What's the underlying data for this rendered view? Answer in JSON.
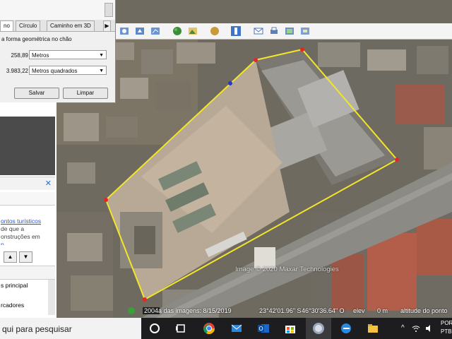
{
  "ruler": {
    "tabs": [
      "no",
      "Círculo",
      "Caminho em 3D"
    ],
    "tab_arrow": "▶",
    "instructions": "a forma geométrica no chão",
    "perimeter": {
      "value": "258,89",
      "unit": "Metros"
    },
    "area": {
      "value": "3.983,22",
      "unit": "Metros quadrados"
    },
    "save_label": "Salvar",
    "clear_label": "Limpar"
  },
  "left_panel": {
    "close": "✕",
    "link_line": "ontos turísticos",
    "text_line1": "de que a",
    "text_line2": "onstruções em",
    "text_line3": "p...",
    "item1": "s principal",
    "item2": "rcadores"
  },
  "map": {
    "copyright": "Image © 2020 Maxar Technologies"
  },
  "status": {
    "year": "2004",
    "imagery_date": "a das imagens: 8/15/2019",
    "lat": "23°42'01.96\" S",
    "lon": "46°30'36.64\" O",
    "elev_label": "elev",
    "elev_value": "0 m",
    "eye_alt": "altitude do ponto"
  },
  "taskbar": {
    "search_text": "qui para pesquisar",
    "lang": "POR",
    "lang2": "PTB"
  },
  "colors": {
    "polygon": "#f2e52a",
    "vertex": "#e8242b",
    "taskbar": "#1d1d1f"
  }
}
